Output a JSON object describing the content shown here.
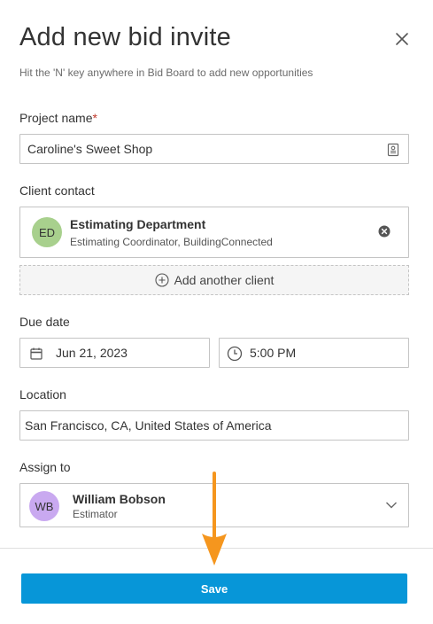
{
  "dialog": {
    "title": "Add new bid invite",
    "subtitle": "Hit the 'N' key anywhere in Bid Board to add new opportunities"
  },
  "project": {
    "label": "Project name",
    "required_mark": "*",
    "value": "Caroline's Sweet Shop"
  },
  "client": {
    "label": "Client contact",
    "initials": "ED",
    "name": "Estimating Department",
    "role": "Estimating Coordinator, BuildingConnected",
    "avatar_color": "#a8d08d",
    "add_label": "Add another client"
  },
  "due": {
    "label": "Due date",
    "date": "Jun 21, 2023",
    "time": "5:00 PM"
  },
  "location": {
    "label": "Location",
    "value": "San Francisco, CA, United States of America"
  },
  "assign": {
    "label": "Assign to",
    "initials": "WB",
    "name": "William Bobson",
    "role": "Estimator",
    "avatar_color": "#c9a9f0"
  },
  "footer": {
    "save_label": "Save"
  },
  "colors": {
    "accent": "#0796d8",
    "annotation_arrow": "#f5961e"
  }
}
